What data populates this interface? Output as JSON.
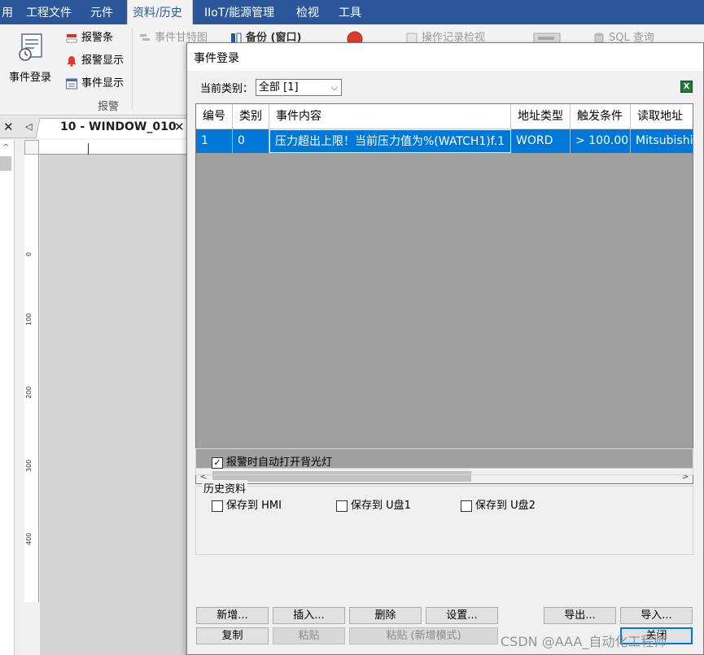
{
  "menubar": {
    "items": [
      "用",
      "工程文件",
      "元件",
      "资料/历史",
      "IIoT/能源管理",
      "检视",
      "工具"
    ],
    "active_index": 3
  },
  "ribbon": {
    "big_button": "事件登录",
    "alarm_items": [
      "报警条",
      "报警显示",
      "事件显示"
    ],
    "group_label": "报警",
    "disabled_items": [
      "事件甘特图",
      "备份 (窗口)",
      "操作记录检视",
      "SQL 查询"
    ]
  },
  "workspace": {
    "tab_label": "10 - WINDOW_010",
    "ruler_numbers": [
      "0",
      "100",
      "200",
      "300",
      "400"
    ]
  },
  "dialog": {
    "title": "事件登录",
    "category_label": "当前类别：",
    "category_value": "全部 [1]",
    "table": {
      "headers": [
        "编号",
        "类别",
        "事件内容",
        "地址类型",
        "触发条件",
        "读取地址"
      ],
      "rows": [
        [
          "1",
          "0",
          "压力超出上限！当前压力值为%(WATCH1)f.1",
          "WORD",
          "> 100.00",
          "Mitsubishi"
        ]
      ]
    },
    "backlight_option": "报警时自动打开背光灯",
    "backlight_checked": true,
    "history_title": "历史资料",
    "history_options": [
      "保存到 HMI",
      "保存到 U盘1",
      "保存到 U盘2"
    ],
    "buttons_row1": [
      "新增...",
      "插入...",
      "删除",
      "设置...",
      "导出...",
      "导入..."
    ],
    "buttons_row2": [
      "复制",
      "粘贴",
      "粘贴 (新增模式)",
      "关闭"
    ]
  },
  "watermark": "CSDN @AAA_自动化工程师",
  "colors": {
    "ribbon_blue": "#2b579a",
    "selection_blue": "#0078d7",
    "grid_background": "#a0a0a0"
  }
}
